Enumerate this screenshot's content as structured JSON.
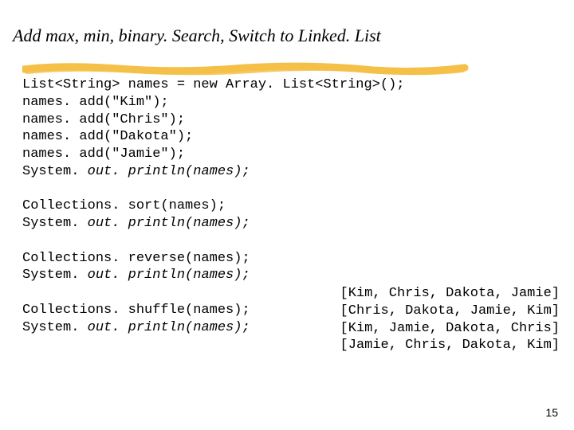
{
  "title": "Add max, min, binary. Search,  Switch to Linked. List",
  "code": {
    "line1": "List<String> names = new Array. List<String>();",
    "line2": "names. add(\"Kim\");",
    "line3": "names. add(\"Chris\");",
    "line4": "names. add(\"Dakota\");",
    "line5": "names. add(\"Jamie\");",
    "line6a": "System. ",
    "line6b": "out. println(names);",
    "line7": "",
    "line8": "Collections. sort(names);",
    "line9a": "System. ",
    "line9b": "out. println(names);",
    "line10": "",
    "line11": "Collections. reverse(names);",
    "line12a": "System. ",
    "line12b": "out. println(names);",
    "line13": "",
    "line14": "Collections. shuffle(names);",
    "line15a": "System. ",
    "line15b": "out. println(names);"
  },
  "output": {
    "line1": "[Kim, Chris, Dakota, Jamie]",
    "line2": "[Chris, Dakota, Jamie, Kim]",
    "line3": "[Kim, Jamie, Dakota, Chris]",
    "line4": "[Jamie, Chris, Dakota, Kim]"
  },
  "page_number": "15"
}
